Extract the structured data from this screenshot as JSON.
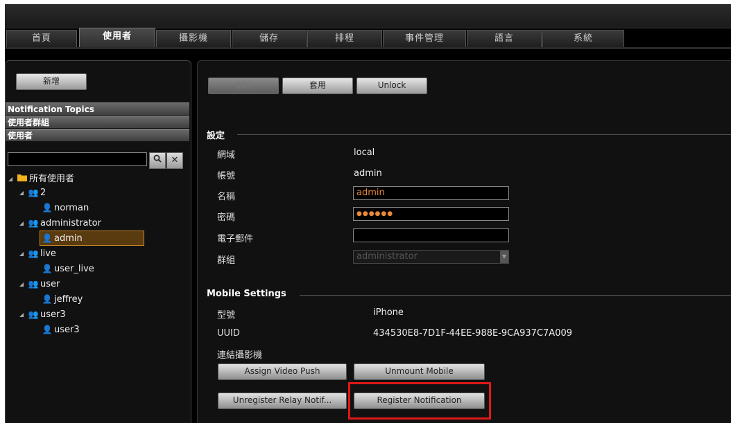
{
  "tabs": [
    "首頁",
    "使用者",
    "攝影機",
    "儲存",
    "排程",
    "事件管理",
    "語言",
    "系統"
  ],
  "active_tab": 1,
  "left": {
    "add_button": "新增",
    "sections": [
      "Notification Topics",
      "使用者群組",
      "使用者"
    ],
    "search_placeholder": "",
    "tree": {
      "root": "所有使用者",
      "groups": [
        {
          "name": "2",
          "users": [
            "norman"
          ]
        },
        {
          "name": "administrator",
          "users": [
            "admin"
          ]
        },
        {
          "name": "live",
          "users": [
            "user_live"
          ]
        },
        {
          "name": "user",
          "users": [
            "jeffrey"
          ]
        },
        {
          "name": "user3",
          "users": [
            "user3"
          ]
        }
      ],
      "selected_user": "admin"
    }
  },
  "right": {
    "buttons": {
      "delete": "刪除",
      "apply": "套用",
      "unlock": "Unlock"
    },
    "settings": {
      "legend": "設定",
      "domain_label": "網域",
      "domain_value": "local",
      "account_label": "帳號",
      "account_value": "admin",
      "name_label": "名稱",
      "name_value": "admin",
      "password_label": "密碼",
      "password_value": "●●●●●●",
      "email_label": "電子郵件",
      "email_value": "",
      "group_label": "群組",
      "group_value": "administrator"
    },
    "mobile": {
      "legend": "Mobile Settings",
      "model_label": "型號",
      "model_value": "iPhone",
      "uuid_label": "UUID",
      "uuid_value": "434530E8-7D1F-44EE-988E-9CA937C7A009",
      "link_camera_label": "連結攝影機",
      "assign_video_push": "Assign Video Push",
      "unmount_mobile": "Unmount Mobile",
      "unregister_relay": "Unregister Relay Notif...",
      "register_notification": "Register Notification"
    }
  },
  "colors": {
    "highlight": "#e01818",
    "field_text": "#e8893a",
    "selection": "#5a3a0f"
  }
}
